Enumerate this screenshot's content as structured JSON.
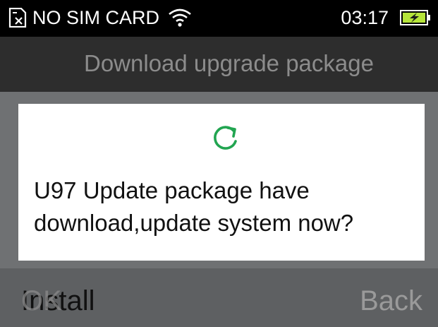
{
  "status_bar": {
    "sim_icon": "sim-card-x-icon",
    "carrier_text": "NO SIM CARD",
    "wifi_icon": "wifi-icon",
    "time": "03:17",
    "battery_icon": "battery-charging-icon"
  },
  "title_bar": {
    "title": "Download upgrade package"
  },
  "dialog": {
    "icon": "refresh-icon",
    "message_line1": "U97 Update package have",
    "message_line2": "download,update system now?"
  },
  "softkeys": {
    "left_label_under": "Install",
    "left_label_over": "OK",
    "right_label": "Back"
  },
  "colors": {
    "accent_green": "#22a551",
    "title_bar_bg": "#2d2d2d",
    "dim_bg": "#6f7173",
    "battery_fill": "#b6e53a"
  }
}
